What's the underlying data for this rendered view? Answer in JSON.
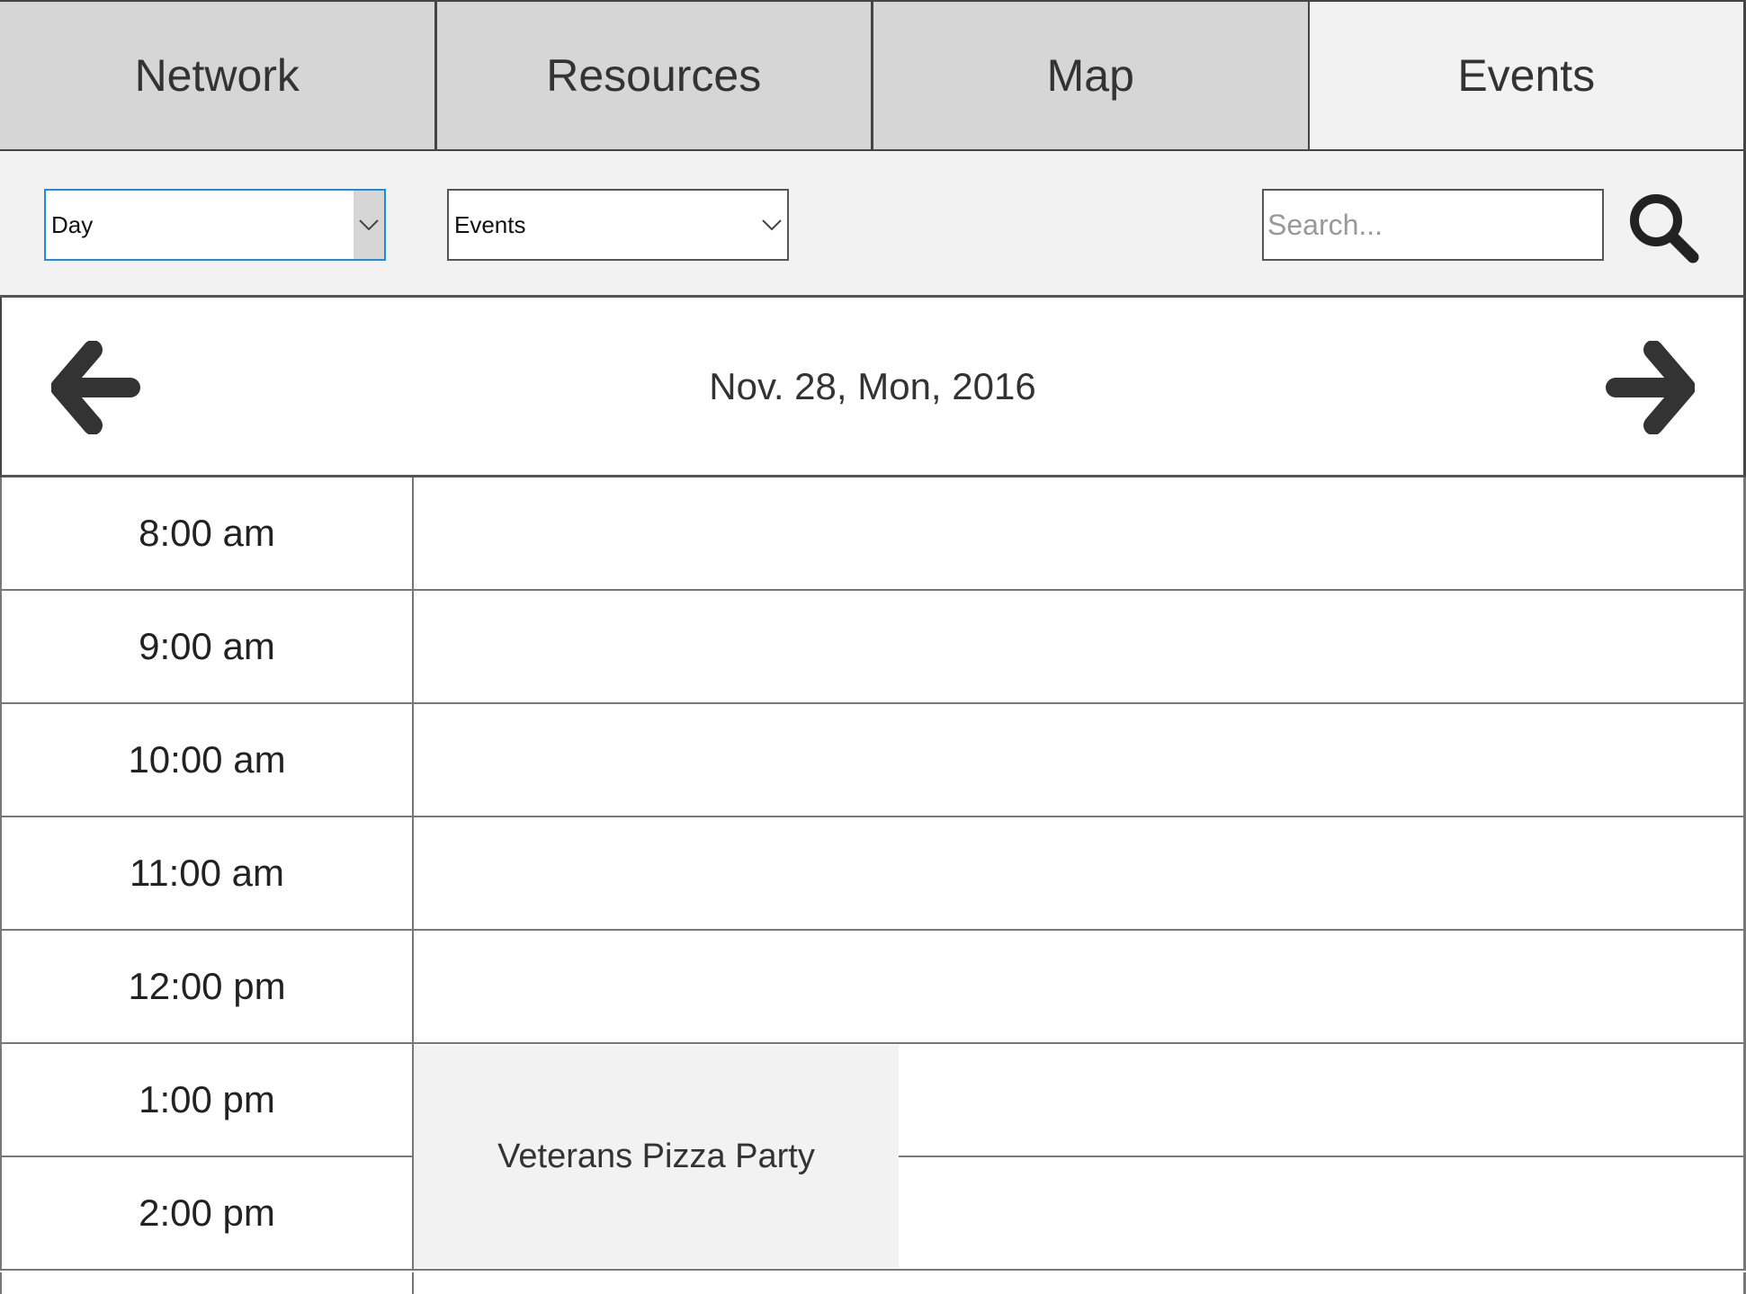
{
  "tabs": [
    {
      "label": "Network",
      "active": false
    },
    {
      "label": "Resources",
      "active": false
    },
    {
      "label": "Map",
      "active": false
    },
    {
      "label": "Events",
      "active": true
    }
  ],
  "toolbar": {
    "view_select": {
      "value": "Day"
    },
    "filter_select": {
      "value": "Events"
    },
    "search": {
      "placeholder": "Search...",
      "value": ""
    },
    "search_icon": "search-icon"
  },
  "day_nav": {
    "date": "Nov. 28, Mon, 2016",
    "prev_icon": "arrow-left-icon",
    "next_icon": "arrow-right-icon"
  },
  "schedule": {
    "times": [
      "8:00 am",
      "9:00 am",
      "10:00 am",
      "11:00 am",
      "12:00 pm",
      "1:00 pm",
      "2:00 pm"
    ],
    "events": [
      {
        "title": "Veterans Pizza Party",
        "start": "1:00 pm",
        "end": "3:00 pm"
      }
    ]
  },
  "colors": {
    "tab_inactive": "#d6d6d6",
    "tab_active": "#f2f2f2",
    "toolbar_bg": "#f2f2f2",
    "focus_border": "#1e8ce0",
    "event_bg": "#f2f2f2",
    "text": "#333333"
  }
}
